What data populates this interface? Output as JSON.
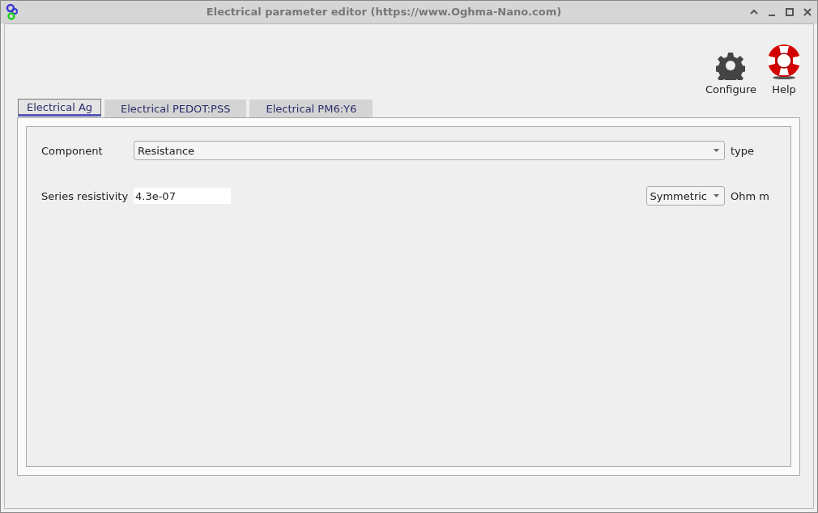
{
  "window": {
    "title": "Electrical parameter editor (https://www.Oghma-Nano.com)"
  },
  "toolbar": [
    {
      "kind": "gear",
      "label": "Configure"
    },
    {
      "kind": "lifebuoy",
      "label": "Help"
    }
  ],
  "tabs": [
    {
      "label": "Electrical Ag",
      "selected": true
    },
    {
      "label": "Electrical PEDOT:PSS",
      "selected": false
    },
    {
      "label": "Electrical PM6:Y6",
      "selected": false
    }
  ],
  "fields": [
    {
      "kind": "dropdown",
      "label": "Component",
      "value": "Resistance",
      "unit": "type"
    },
    {
      "kind": "text",
      "label": "Series resistivity",
      "value": "4.3e-07",
      "mode": "Symmetric",
      "unit": "Ohm m"
    }
  ]
}
